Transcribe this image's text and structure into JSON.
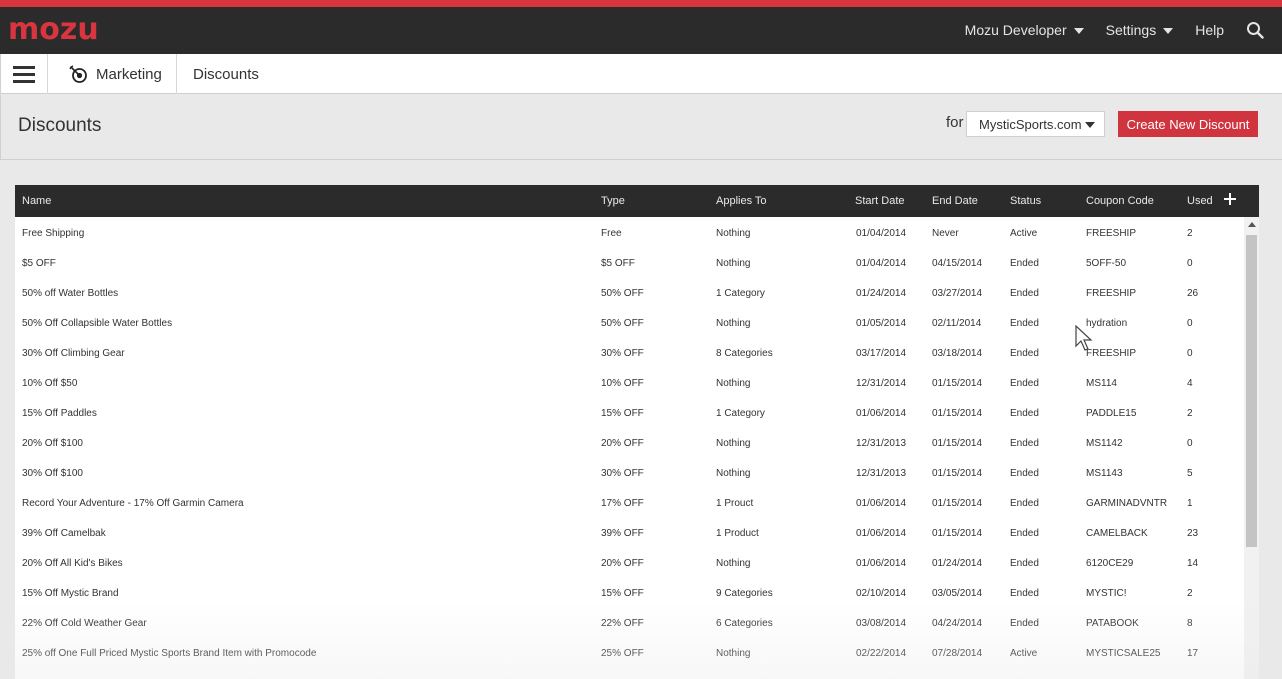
{
  "brand": {
    "logo_text": "mozu",
    "accent_color": "#d9353f"
  },
  "topnav": {
    "account_label": "Mozu Developer",
    "settings_label": "Settings",
    "help_label": "Help",
    "search_icon": "search-icon"
  },
  "subnav": {
    "menu_icon": "hamburger-icon",
    "marketing_label": "Marketing",
    "marketing_icon": "target-icon",
    "current_label": "Discounts"
  },
  "page": {
    "title": "Discounts",
    "for_label": "for",
    "site_selected": "MysticSports.com",
    "create_button_label": "Create New Discount"
  },
  "table": {
    "headers": {
      "name": "Name",
      "type": "Type",
      "applies_to": "Applies To",
      "start_date": "Start Date",
      "end_date": "End Date",
      "status": "Status",
      "coupon_code": "Coupon Code",
      "used": "Used"
    },
    "rows": [
      {
        "name": "Free Shipping",
        "type": "Free",
        "applies_to": "Nothing",
        "start_date": "01/04/2014",
        "end_date": "Never",
        "status": "Active",
        "coupon_code": "FREESHIP",
        "used": "2"
      },
      {
        "name": "$5 OFF",
        "type": "$5 OFF",
        "applies_to": "Nothing",
        "start_date": "01/04/2014",
        "end_date": "04/15/2014",
        "status": "Ended",
        "coupon_code": "5OFF-50",
        "used": "0"
      },
      {
        "name": "50% off Water Bottles",
        "type": "50% OFF",
        "applies_to": "1 Category",
        "start_date": "01/24/2014",
        "end_date": "03/27/2014",
        "status": "Ended",
        "coupon_code": "FREESHIP",
        "used": "26"
      },
      {
        "name": "50% Off Collapsible Water Bottles",
        "type": "50% OFF",
        "applies_to": "Nothing",
        "start_date": "01/05/2014",
        "end_date": "02/11/2014",
        "status": "Ended",
        "coupon_code": "hydration",
        "used": "0"
      },
      {
        "name": "30% Off Climbing Gear",
        "type": "30% OFF",
        "applies_to": "8 Categories",
        "start_date": "03/17/2014",
        "end_date": "03/18/2014",
        "status": "Ended",
        "coupon_code": "FREESHIP",
        "used": "0"
      },
      {
        "name": "10% Off $50",
        "type": "10% OFF",
        "applies_to": "Nothing",
        "start_date": "12/31/2014",
        "end_date": "01/15/2014",
        "status": "Ended",
        "coupon_code": "MS114",
        "used": "4"
      },
      {
        "name": "15% Off Paddles",
        "type": "15% OFF",
        "applies_to": "1 Category",
        "start_date": "01/06/2014",
        "end_date": "01/15/2014",
        "status": "Ended",
        "coupon_code": "PADDLE15",
        "used": "2"
      },
      {
        "name": "20% Off $100",
        "type": "20% OFF",
        "applies_to": "Nothing",
        "start_date": "12/31/2013",
        "end_date": "01/15/2014",
        "status": "Ended",
        "coupon_code": "MS1142",
        "used": "0"
      },
      {
        "name": "30% Off $100",
        "type": "30% OFF",
        "applies_to": "Nothing",
        "start_date": "12/31/2013",
        "end_date": "01/15/2014",
        "status": "Ended",
        "coupon_code": "MS1143",
        "used": "5"
      },
      {
        "name": "Record Your Adventure - 17% Off Garmin Camera",
        "type": "17% OFF",
        "applies_to": "1 Prouct",
        "start_date": "01/06/2014",
        "end_date": "01/15/2014",
        "status": "Ended",
        "coupon_code": "GARMINADVNTR",
        "used": "1"
      },
      {
        "name": "39% Off Camelbak",
        "type": "39% OFF",
        "applies_to": "1 Product",
        "start_date": "01/06/2014",
        "end_date": "01/15/2014",
        "status": "Ended",
        "coupon_code": "CAMELBACK",
        "used": "23"
      },
      {
        "name": "20% Off All Kid's Bikes",
        "type": "20% OFF",
        "applies_to": "Nothing",
        "start_date": "01/06/2014",
        "end_date": "01/24/2014",
        "status": "Ended",
        "coupon_code": "6120CE29",
        "used": "14"
      },
      {
        "name": "15% Off Mystic Brand",
        "type": "15% OFF",
        "applies_to": "9 Categories",
        "start_date": "02/10/2014",
        "end_date": "03/05/2014",
        "status": "Ended",
        "coupon_code": "MYSTIC!",
        "used": "2"
      },
      {
        "name": "22% Off Cold Weather Gear",
        "type": "22% OFF",
        "applies_to": "6 Categories",
        "start_date": "03/08/2014",
        "end_date": "04/24/2014",
        "status": "Ended",
        "coupon_code": "PATABOOK",
        "used": "8"
      },
      {
        "name": "25% off One Full Priced Mystic Sports Brand Item with Promocode",
        "type": "25% OFF",
        "applies_to": "Nothing",
        "start_date": "02/22/2014",
        "end_date": "07/28/2014",
        "status": "Active",
        "coupon_code": "MYSTICSALE25",
        "used": "17"
      }
    ]
  }
}
